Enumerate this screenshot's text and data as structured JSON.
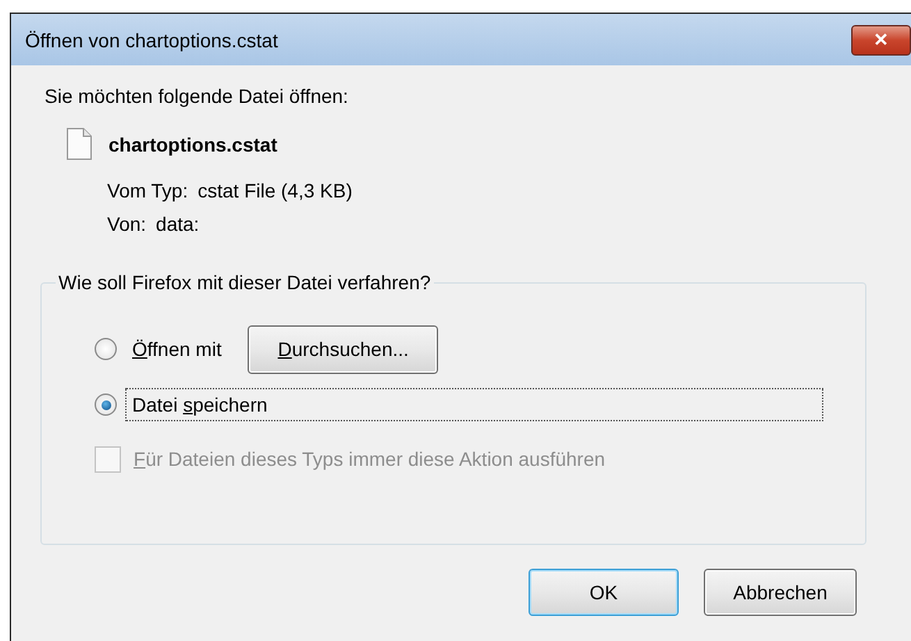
{
  "window": {
    "title": "Öffnen von chartoptions.cstat",
    "close_label": "✕"
  },
  "intro": "Sie möchten folgende Datei öffnen:",
  "file": {
    "name": "chartoptions.cstat",
    "details": [
      {
        "label": "Vom Typ:",
        "value": "cstat File (4,3 KB)"
      },
      {
        "label": "Von:",
        "value": "data:"
      }
    ]
  },
  "action_group": {
    "legend": "Wie soll Firefox mit dieser Datei verfahren?",
    "options": [
      {
        "label": [
          {
            "text": "Ö",
            "underlined": true
          },
          {
            "text": "ffnen mit",
            "underlined": false
          }
        ],
        "selected": false,
        "focused": false,
        "button": {
          "label": [
            {
              "text": "D",
              "underlined": true
            },
            {
              "text": "urchsuchen...",
              "underlined": false
            }
          ]
        }
      },
      {
        "label": [
          {
            "text": "Datei ",
            "underlined": false
          },
          {
            "text": "s",
            "underlined": true
          },
          {
            "text": "peichern",
            "underlined": false
          }
        ],
        "selected": true,
        "focused": true
      }
    ],
    "remember": {
      "label": [
        {
          "text": "F",
          "underlined": true
        },
        {
          "text": "ür Dateien dieses Typs immer diese Aktion ausführen",
          "underlined": false
        }
      ],
      "checked": false,
      "disabled": true
    }
  },
  "buttons": [
    {
      "label": "OK",
      "default": true
    },
    {
      "label": "Abbrechen",
      "default": false
    }
  ]
}
